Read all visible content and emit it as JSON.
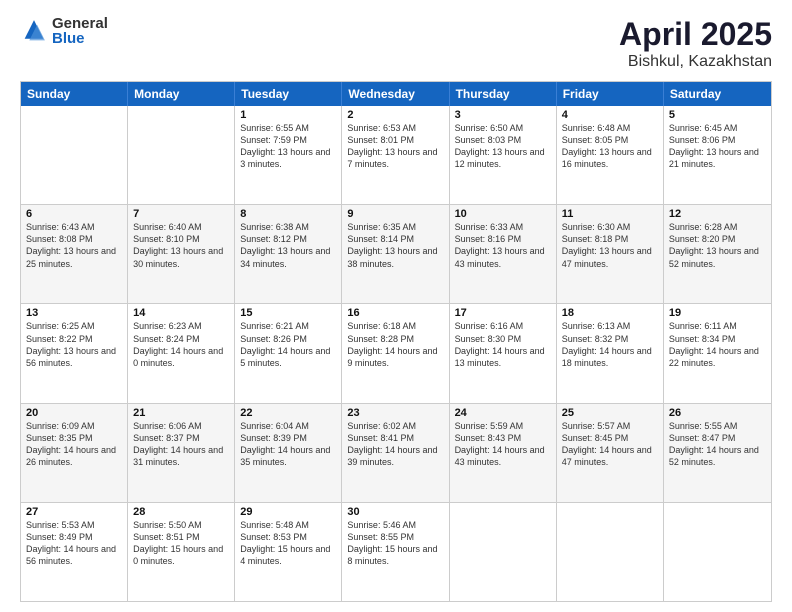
{
  "logo": {
    "general": "General",
    "blue": "Blue"
  },
  "header": {
    "month": "April 2025",
    "location": "Bishkul, Kazakhstan"
  },
  "weekdays": [
    "Sunday",
    "Monday",
    "Tuesday",
    "Wednesday",
    "Thursday",
    "Friday",
    "Saturday"
  ],
  "rows": [
    [
      {
        "day": "",
        "info": ""
      },
      {
        "day": "",
        "info": ""
      },
      {
        "day": "1",
        "info": "Sunrise: 6:55 AM\nSunset: 7:59 PM\nDaylight: 13 hours and 3 minutes."
      },
      {
        "day": "2",
        "info": "Sunrise: 6:53 AM\nSunset: 8:01 PM\nDaylight: 13 hours and 7 minutes."
      },
      {
        "day": "3",
        "info": "Sunrise: 6:50 AM\nSunset: 8:03 PM\nDaylight: 13 hours and 12 minutes."
      },
      {
        "day": "4",
        "info": "Sunrise: 6:48 AM\nSunset: 8:05 PM\nDaylight: 13 hours and 16 minutes."
      },
      {
        "day": "5",
        "info": "Sunrise: 6:45 AM\nSunset: 8:06 PM\nDaylight: 13 hours and 21 minutes."
      }
    ],
    [
      {
        "day": "6",
        "info": "Sunrise: 6:43 AM\nSunset: 8:08 PM\nDaylight: 13 hours and 25 minutes."
      },
      {
        "day": "7",
        "info": "Sunrise: 6:40 AM\nSunset: 8:10 PM\nDaylight: 13 hours and 30 minutes."
      },
      {
        "day": "8",
        "info": "Sunrise: 6:38 AM\nSunset: 8:12 PM\nDaylight: 13 hours and 34 minutes."
      },
      {
        "day": "9",
        "info": "Sunrise: 6:35 AM\nSunset: 8:14 PM\nDaylight: 13 hours and 38 minutes."
      },
      {
        "day": "10",
        "info": "Sunrise: 6:33 AM\nSunset: 8:16 PM\nDaylight: 13 hours and 43 minutes."
      },
      {
        "day": "11",
        "info": "Sunrise: 6:30 AM\nSunset: 8:18 PM\nDaylight: 13 hours and 47 minutes."
      },
      {
        "day": "12",
        "info": "Sunrise: 6:28 AM\nSunset: 8:20 PM\nDaylight: 13 hours and 52 minutes."
      }
    ],
    [
      {
        "day": "13",
        "info": "Sunrise: 6:25 AM\nSunset: 8:22 PM\nDaylight: 13 hours and 56 minutes."
      },
      {
        "day": "14",
        "info": "Sunrise: 6:23 AM\nSunset: 8:24 PM\nDaylight: 14 hours and 0 minutes."
      },
      {
        "day": "15",
        "info": "Sunrise: 6:21 AM\nSunset: 8:26 PM\nDaylight: 14 hours and 5 minutes."
      },
      {
        "day": "16",
        "info": "Sunrise: 6:18 AM\nSunset: 8:28 PM\nDaylight: 14 hours and 9 minutes."
      },
      {
        "day": "17",
        "info": "Sunrise: 6:16 AM\nSunset: 8:30 PM\nDaylight: 14 hours and 13 minutes."
      },
      {
        "day": "18",
        "info": "Sunrise: 6:13 AM\nSunset: 8:32 PM\nDaylight: 14 hours and 18 minutes."
      },
      {
        "day": "19",
        "info": "Sunrise: 6:11 AM\nSunset: 8:34 PM\nDaylight: 14 hours and 22 minutes."
      }
    ],
    [
      {
        "day": "20",
        "info": "Sunrise: 6:09 AM\nSunset: 8:35 PM\nDaylight: 14 hours and 26 minutes."
      },
      {
        "day": "21",
        "info": "Sunrise: 6:06 AM\nSunset: 8:37 PM\nDaylight: 14 hours and 31 minutes."
      },
      {
        "day": "22",
        "info": "Sunrise: 6:04 AM\nSunset: 8:39 PM\nDaylight: 14 hours and 35 minutes."
      },
      {
        "day": "23",
        "info": "Sunrise: 6:02 AM\nSunset: 8:41 PM\nDaylight: 14 hours and 39 minutes."
      },
      {
        "day": "24",
        "info": "Sunrise: 5:59 AM\nSunset: 8:43 PM\nDaylight: 14 hours and 43 minutes."
      },
      {
        "day": "25",
        "info": "Sunrise: 5:57 AM\nSunset: 8:45 PM\nDaylight: 14 hours and 47 minutes."
      },
      {
        "day": "26",
        "info": "Sunrise: 5:55 AM\nSunset: 8:47 PM\nDaylight: 14 hours and 52 minutes."
      }
    ],
    [
      {
        "day": "27",
        "info": "Sunrise: 5:53 AM\nSunset: 8:49 PM\nDaylight: 14 hours and 56 minutes."
      },
      {
        "day": "28",
        "info": "Sunrise: 5:50 AM\nSunset: 8:51 PM\nDaylight: 15 hours and 0 minutes."
      },
      {
        "day": "29",
        "info": "Sunrise: 5:48 AM\nSunset: 8:53 PM\nDaylight: 15 hours and 4 minutes."
      },
      {
        "day": "30",
        "info": "Sunrise: 5:46 AM\nSunset: 8:55 PM\nDaylight: 15 hours and 8 minutes."
      },
      {
        "day": "",
        "info": ""
      },
      {
        "day": "",
        "info": ""
      },
      {
        "day": "",
        "info": ""
      }
    ]
  ]
}
